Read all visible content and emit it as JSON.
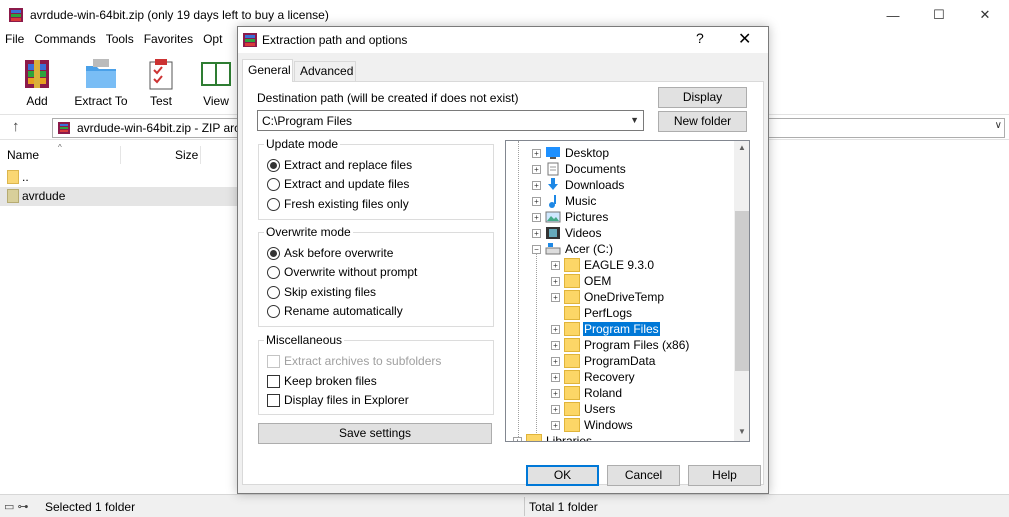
{
  "window": {
    "title": "avrdude-win-64bit.zip (only 19 days left to buy a license)",
    "minimize": "—",
    "maximize": "☐",
    "close": "✕"
  },
  "menu": [
    "File",
    "Commands",
    "Tools",
    "Favorites",
    "Opt"
  ],
  "toolbar": [
    {
      "label": "Add",
      "icon": "add-archive-icon"
    },
    {
      "label": "Extract To",
      "icon": "extract-to-icon"
    },
    {
      "label": "Test",
      "icon": "test-icon"
    },
    {
      "label": "View",
      "icon": "view-book-icon"
    }
  ],
  "address": {
    "up": "↑",
    "path": "avrdude-win-64bit.zip - ZIP arc",
    "dropdown": "∨"
  },
  "columns": {
    "name": "Name",
    "size": "Size",
    "sort_indicator": "^"
  },
  "files": [
    {
      "name": ".."
    },
    {
      "name": "avrdude"
    }
  ],
  "status": {
    "left": "Selected 1 folder",
    "right": "Total 1 folder"
  },
  "dialog": {
    "title": "Extraction path and options",
    "help": "?",
    "close": "✕",
    "tabs": {
      "general": "General",
      "advanced": "Advanced"
    },
    "destination_label": "Destination path (will be created if does not exist)",
    "destination_value": "C:\\Program Files",
    "display_button": "Display",
    "new_folder_button": "New folder",
    "update_mode": {
      "title": "Update mode",
      "options": [
        {
          "label": "Extract and replace files",
          "selected": true
        },
        {
          "label": "Extract and update files",
          "selected": false
        },
        {
          "label": "Fresh existing files only",
          "selected": false
        }
      ]
    },
    "overwrite_mode": {
      "title": "Overwrite mode",
      "options": [
        {
          "label": "Ask before overwrite",
          "selected": true
        },
        {
          "label": "Overwrite without prompt",
          "selected": false
        },
        {
          "label": "Skip existing files",
          "selected": false
        },
        {
          "label": "Rename automatically",
          "selected": false
        }
      ]
    },
    "misc": {
      "title": "Miscellaneous",
      "options": [
        {
          "label": "Extract archives to subfolders",
          "checked": false,
          "disabled": true
        },
        {
          "label": "Keep broken files",
          "checked": false,
          "disabled": false
        },
        {
          "label": "Display files in Explorer",
          "checked": false,
          "disabled": false
        }
      ]
    },
    "save_settings": "Save settings",
    "ok": "OK",
    "cancel": "Cancel",
    "help_button": "Help",
    "tree": [
      {
        "label": "Desktop",
        "icon": "desktop-icon"
      },
      {
        "label": "Documents",
        "icon": "documents-icon"
      },
      {
        "label": "Downloads",
        "icon": "downloads-icon"
      },
      {
        "label": "Music",
        "icon": "music-icon"
      },
      {
        "label": "Pictures",
        "icon": "pictures-icon"
      },
      {
        "label": "Videos",
        "icon": "videos-icon"
      },
      {
        "label": "Acer (C:)",
        "icon": "drive-icon"
      },
      {
        "label": "EAGLE 9.3.0",
        "icon": "folder-icon"
      },
      {
        "label": "OEM",
        "icon": "folder-icon"
      },
      {
        "label": "OneDriveTemp",
        "icon": "folder-icon"
      },
      {
        "label": "PerfLogs",
        "icon": "folder-icon"
      },
      {
        "label": "Program Files",
        "icon": "folder-icon",
        "selected": true
      },
      {
        "label": "Program Files (x86)",
        "icon": "folder-icon"
      },
      {
        "label": "ProgramData",
        "icon": "folder-icon"
      },
      {
        "label": "Recovery",
        "icon": "folder-icon"
      },
      {
        "label": "Roland",
        "icon": "folder-icon"
      },
      {
        "label": "Users",
        "icon": "folder-icon"
      },
      {
        "label": "Windows",
        "icon": "folder-icon"
      },
      {
        "label": "Libraries",
        "icon": "libraries-icon"
      }
    ]
  },
  "colors": {
    "selection": "#0078d7",
    "folder": "#fcd667"
  }
}
